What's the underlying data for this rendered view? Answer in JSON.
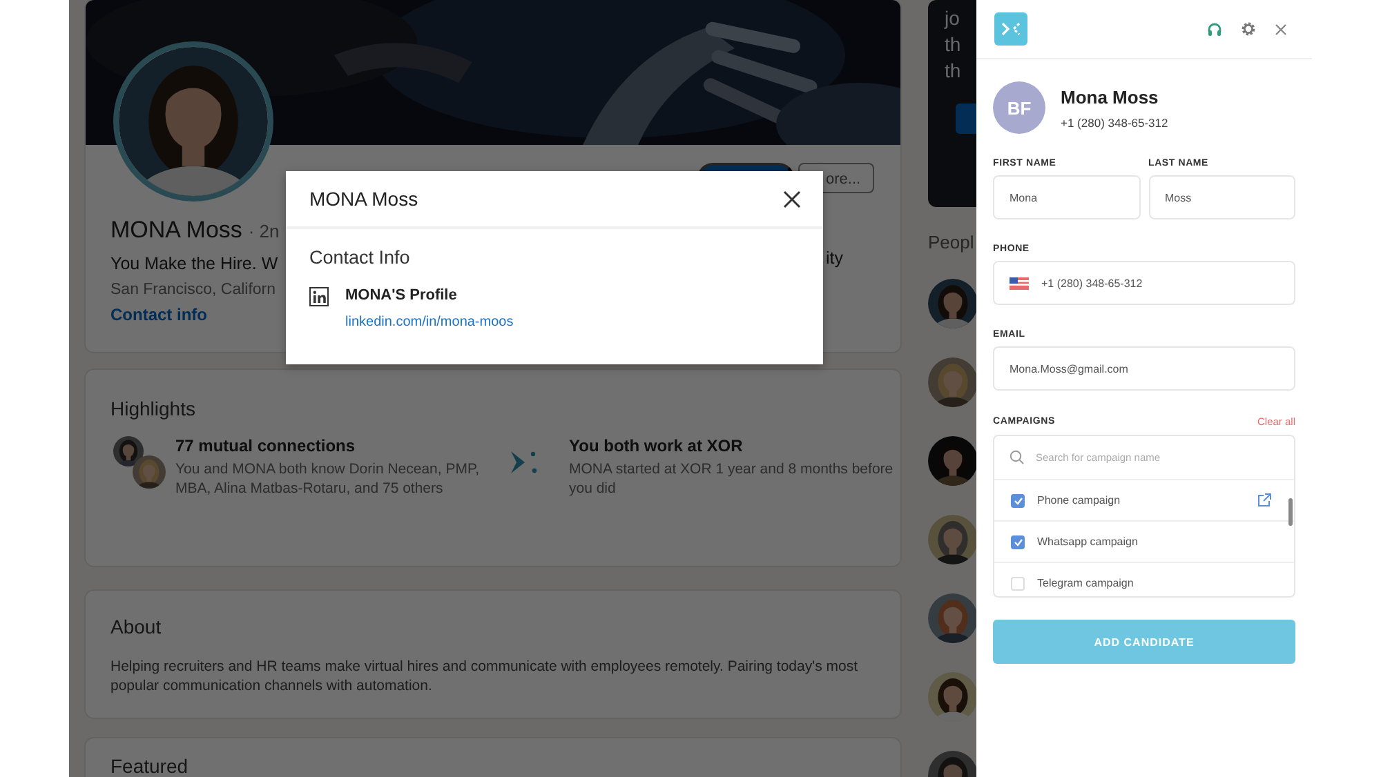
{
  "background_page": {
    "profile": {
      "name": "MONA Moss",
      "degree": "· 2n",
      "headline": "You Make the Hire. W",
      "headline_tail": "ity",
      "location": "San Francisco, Californ",
      "contact_link": "Contact info",
      "more_button": "ore..."
    },
    "sidebar_fragments": [
      "jo",
      "th",
      "th"
    ],
    "people_heading": "Peopl",
    "people": [
      {
        "kind": "picture"
      },
      {
        "kind": "picture"
      },
      {
        "kind": "picture"
      },
      {
        "kind": "picture"
      },
      {
        "kind": "picture"
      },
      {
        "kind": "picture"
      },
      {
        "kind": "picture"
      }
    ],
    "highlights": {
      "title": "Highlights",
      "items": [
        {
          "kind": "connections",
          "title": "77 mutual connections",
          "text": "You and MONA both know Dorin Necean, PMP, MBA, Alina Matbas-Rotaru, and 75 others"
        },
        {
          "kind": "company",
          "title": "You both work at XOR",
          "text": "MONA started at XOR 1 year and 8 months before you did"
        }
      ]
    },
    "about": {
      "title": "About",
      "text": "Helping recruiters and HR teams make virtual hires and communicate with employees remotely. Pairing today's most popular communication channels with automation."
    },
    "featured": {
      "title": "Featured"
    }
  },
  "modal": {
    "title": "MONA Moss",
    "section": "Contact Info",
    "profile_label": "MONA'S Profile",
    "profile_link": "linkedin.com/in/mona-moos"
  },
  "panel": {
    "avatar_initials": "BF",
    "name": "Mona Moss",
    "phone_line": "+1 (280) 348-65-312",
    "fields": [
      {
        "kind": "half",
        "label": "FIRST NAME",
        "value": "Mona"
      },
      {
        "kind": "half",
        "label": "LAST NAME",
        "value": "Moss"
      },
      {
        "kind": "phone",
        "label": "PHONE",
        "value": "+1 (280) 348-65-312"
      },
      {
        "kind": "full",
        "label": "EMAIL",
        "value": "Mona.Moss@gmail.com"
      }
    ],
    "campaigns": {
      "label": "CAMPAIGNS",
      "clear": "Clear all",
      "search_placeholder": "Search for campaign name",
      "items": [
        {
          "name": "Phone campaign",
          "checked": true,
          "link": true
        },
        {
          "name": "Whatsapp campaign",
          "checked": true,
          "link": false
        },
        {
          "name": "Telegram campaign",
          "checked": false,
          "link": false
        }
      ]
    },
    "submit": "ADD CANDIDATE"
  }
}
